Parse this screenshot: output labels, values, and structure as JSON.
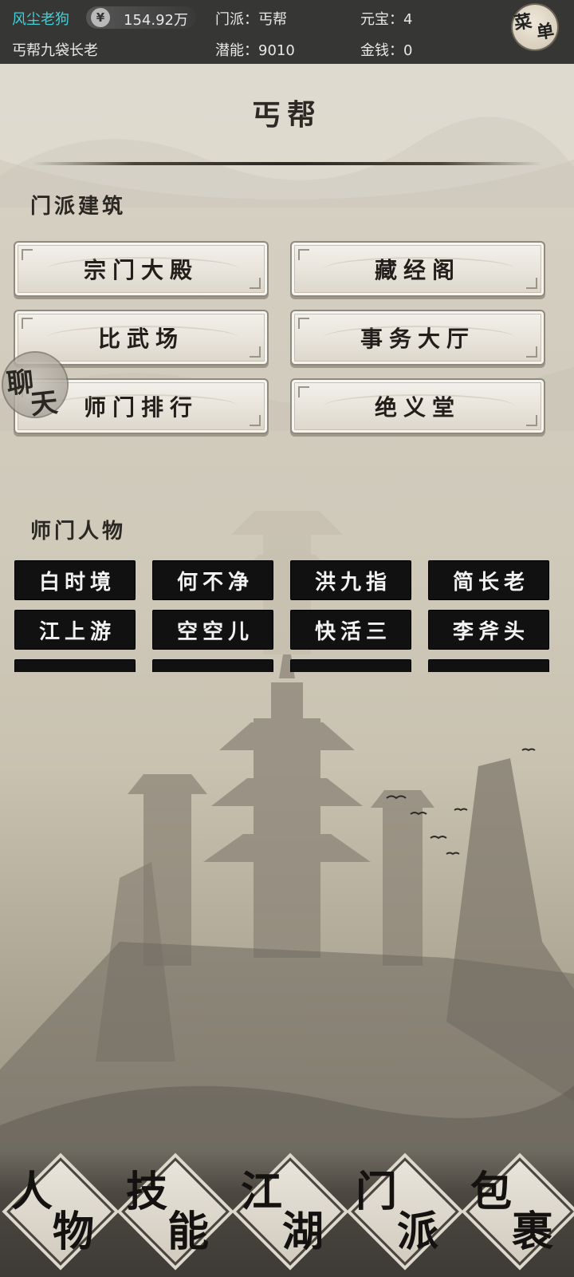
{
  "topbar": {
    "player_name": "风尘老狗",
    "coin_icon": "¥",
    "coin_value": "154.92万",
    "sect": "门派：丐帮",
    "yuanbao": "元宝：4",
    "title": "丐帮九袋长老",
    "potential": "潜能：9010",
    "money": "金钱：0",
    "menu": [
      "菜",
      "单"
    ]
  },
  "page": {
    "title": "丐帮"
  },
  "buildings": {
    "heading": "门派建筑",
    "items": [
      "宗门大殿",
      "藏经阁",
      "比武场",
      "事务大厅",
      "师门排行",
      "绝义堂"
    ]
  },
  "chat": [
    "聊",
    "天"
  ],
  "people": {
    "heading": "师门人物",
    "items": [
      "白时境",
      "何不净",
      "洪九指",
      "简长老",
      "江上游",
      "空空儿",
      "快活三",
      "李斧头"
    ]
  },
  "bottom_nav": [
    {
      "g1": "人",
      "g2": "物"
    },
    {
      "g1": "技",
      "g2": "能"
    },
    {
      "g1": "江",
      "g2": "湖"
    },
    {
      "g1": "门",
      "g2": "派"
    },
    {
      "g1": "包",
      "g2": "裹"
    }
  ]
}
